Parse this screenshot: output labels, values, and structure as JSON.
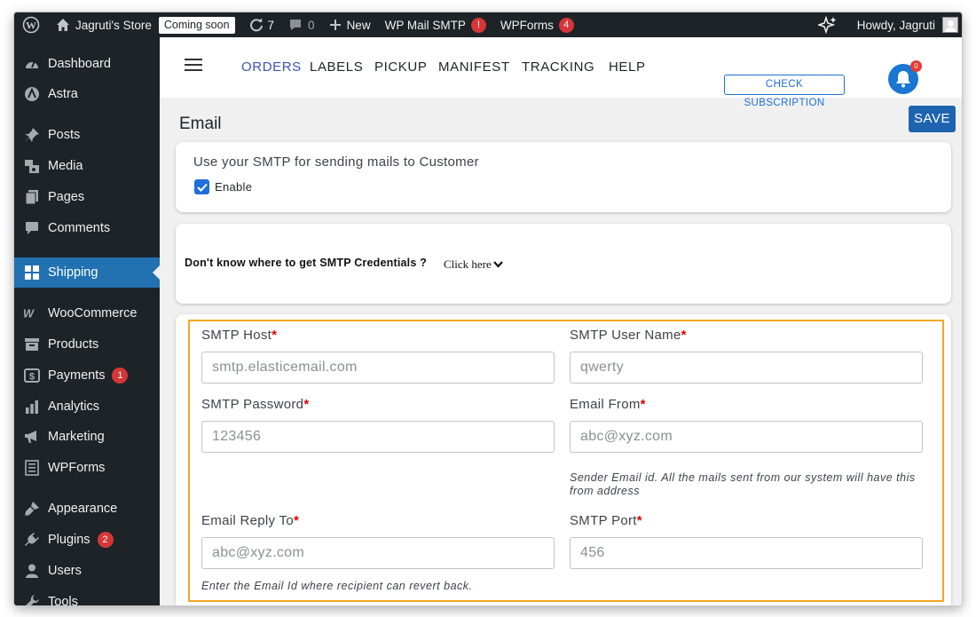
{
  "admin_bar": {
    "site_name": "Jagruti's Store",
    "coming_soon": "Coming soon",
    "updates_count": "7",
    "comments_count": "0",
    "new_label": "New",
    "wp_mail_smtp": "WP Mail SMTP",
    "wp_mail_smtp_badge": "!",
    "wpforms": "WPForms",
    "wpforms_badge": "4",
    "howdy": "Howdy, Jagruti"
  },
  "sidebar": {
    "items": [
      {
        "label": "Dashboard",
        "icon": "dashboard-icon"
      },
      {
        "label": "Astra",
        "icon": "astra-icon"
      },
      {
        "label": "Posts",
        "icon": "pin-icon"
      },
      {
        "label": "Media",
        "icon": "media-icon"
      },
      {
        "label": "Pages",
        "icon": "pages-icon"
      },
      {
        "label": "Comments",
        "icon": "comment-icon"
      },
      {
        "label": "Shipping",
        "icon": "grid-icon",
        "active": true
      },
      {
        "label": "WooCommerce",
        "icon": "woo-icon"
      },
      {
        "label": "Products",
        "icon": "archive-icon"
      },
      {
        "label": "Payments",
        "icon": "dollar-icon",
        "badge": "1"
      },
      {
        "label": "Analytics",
        "icon": "bar-chart-icon"
      },
      {
        "label": "Marketing",
        "icon": "megaphone-icon"
      },
      {
        "label": "WPForms",
        "icon": "form-icon"
      },
      {
        "label": "Appearance",
        "icon": "brush-icon"
      },
      {
        "label": "Plugins",
        "icon": "plug-icon",
        "badge": "2"
      },
      {
        "label": "Users",
        "icon": "user-icon"
      },
      {
        "label": "Tools",
        "icon": "wrench-icon"
      }
    ]
  },
  "topnav": {
    "tabs": [
      {
        "label": "ORDERS",
        "active": true
      },
      {
        "label": "LABELS"
      },
      {
        "label": "PICKUP"
      },
      {
        "label": "MANIFEST"
      },
      {
        "label": "TRACKING"
      },
      {
        "label": "HELP"
      }
    ],
    "check_subscription": "CHECK SUBSCRIPTION",
    "notification_count": "0"
  },
  "page": {
    "title": "Email",
    "save": "SAVE"
  },
  "smtp_card": {
    "label": "Use your SMTP for sending mails to Customer",
    "enable_label": "Enable",
    "enabled": true
  },
  "credentials_card": {
    "question": "Don't know where to get SMTP Credentials ?",
    "click_here": "Click here"
  },
  "form": {
    "required_mark": "*",
    "smtp_host": {
      "label": "SMTP Host",
      "placeholder": "smtp.elasticemail.com"
    },
    "smtp_user": {
      "label": "SMTP User Name",
      "placeholder": "qwerty"
    },
    "smtp_password": {
      "label": "SMTP Password",
      "placeholder": "123456"
    },
    "email_from": {
      "label": "Email From",
      "placeholder": "abc@xyz.com",
      "helper": "Sender Email id. All the mails sent from our system will have this from address"
    },
    "email_reply_to": {
      "label": "Email Reply To",
      "placeholder": "abc@xyz.com",
      "helper": "Enter the Email Id where recipient can revert back."
    },
    "smtp_port": {
      "label": "SMTP Port",
      "placeholder": "456"
    }
  },
  "colors": {
    "admin_bg": "#1d2327",
    "active_blue": "#2271b1",
    "orange_highlight": "#f5a623",
    "badge_red": "#d63638"
  }
}
